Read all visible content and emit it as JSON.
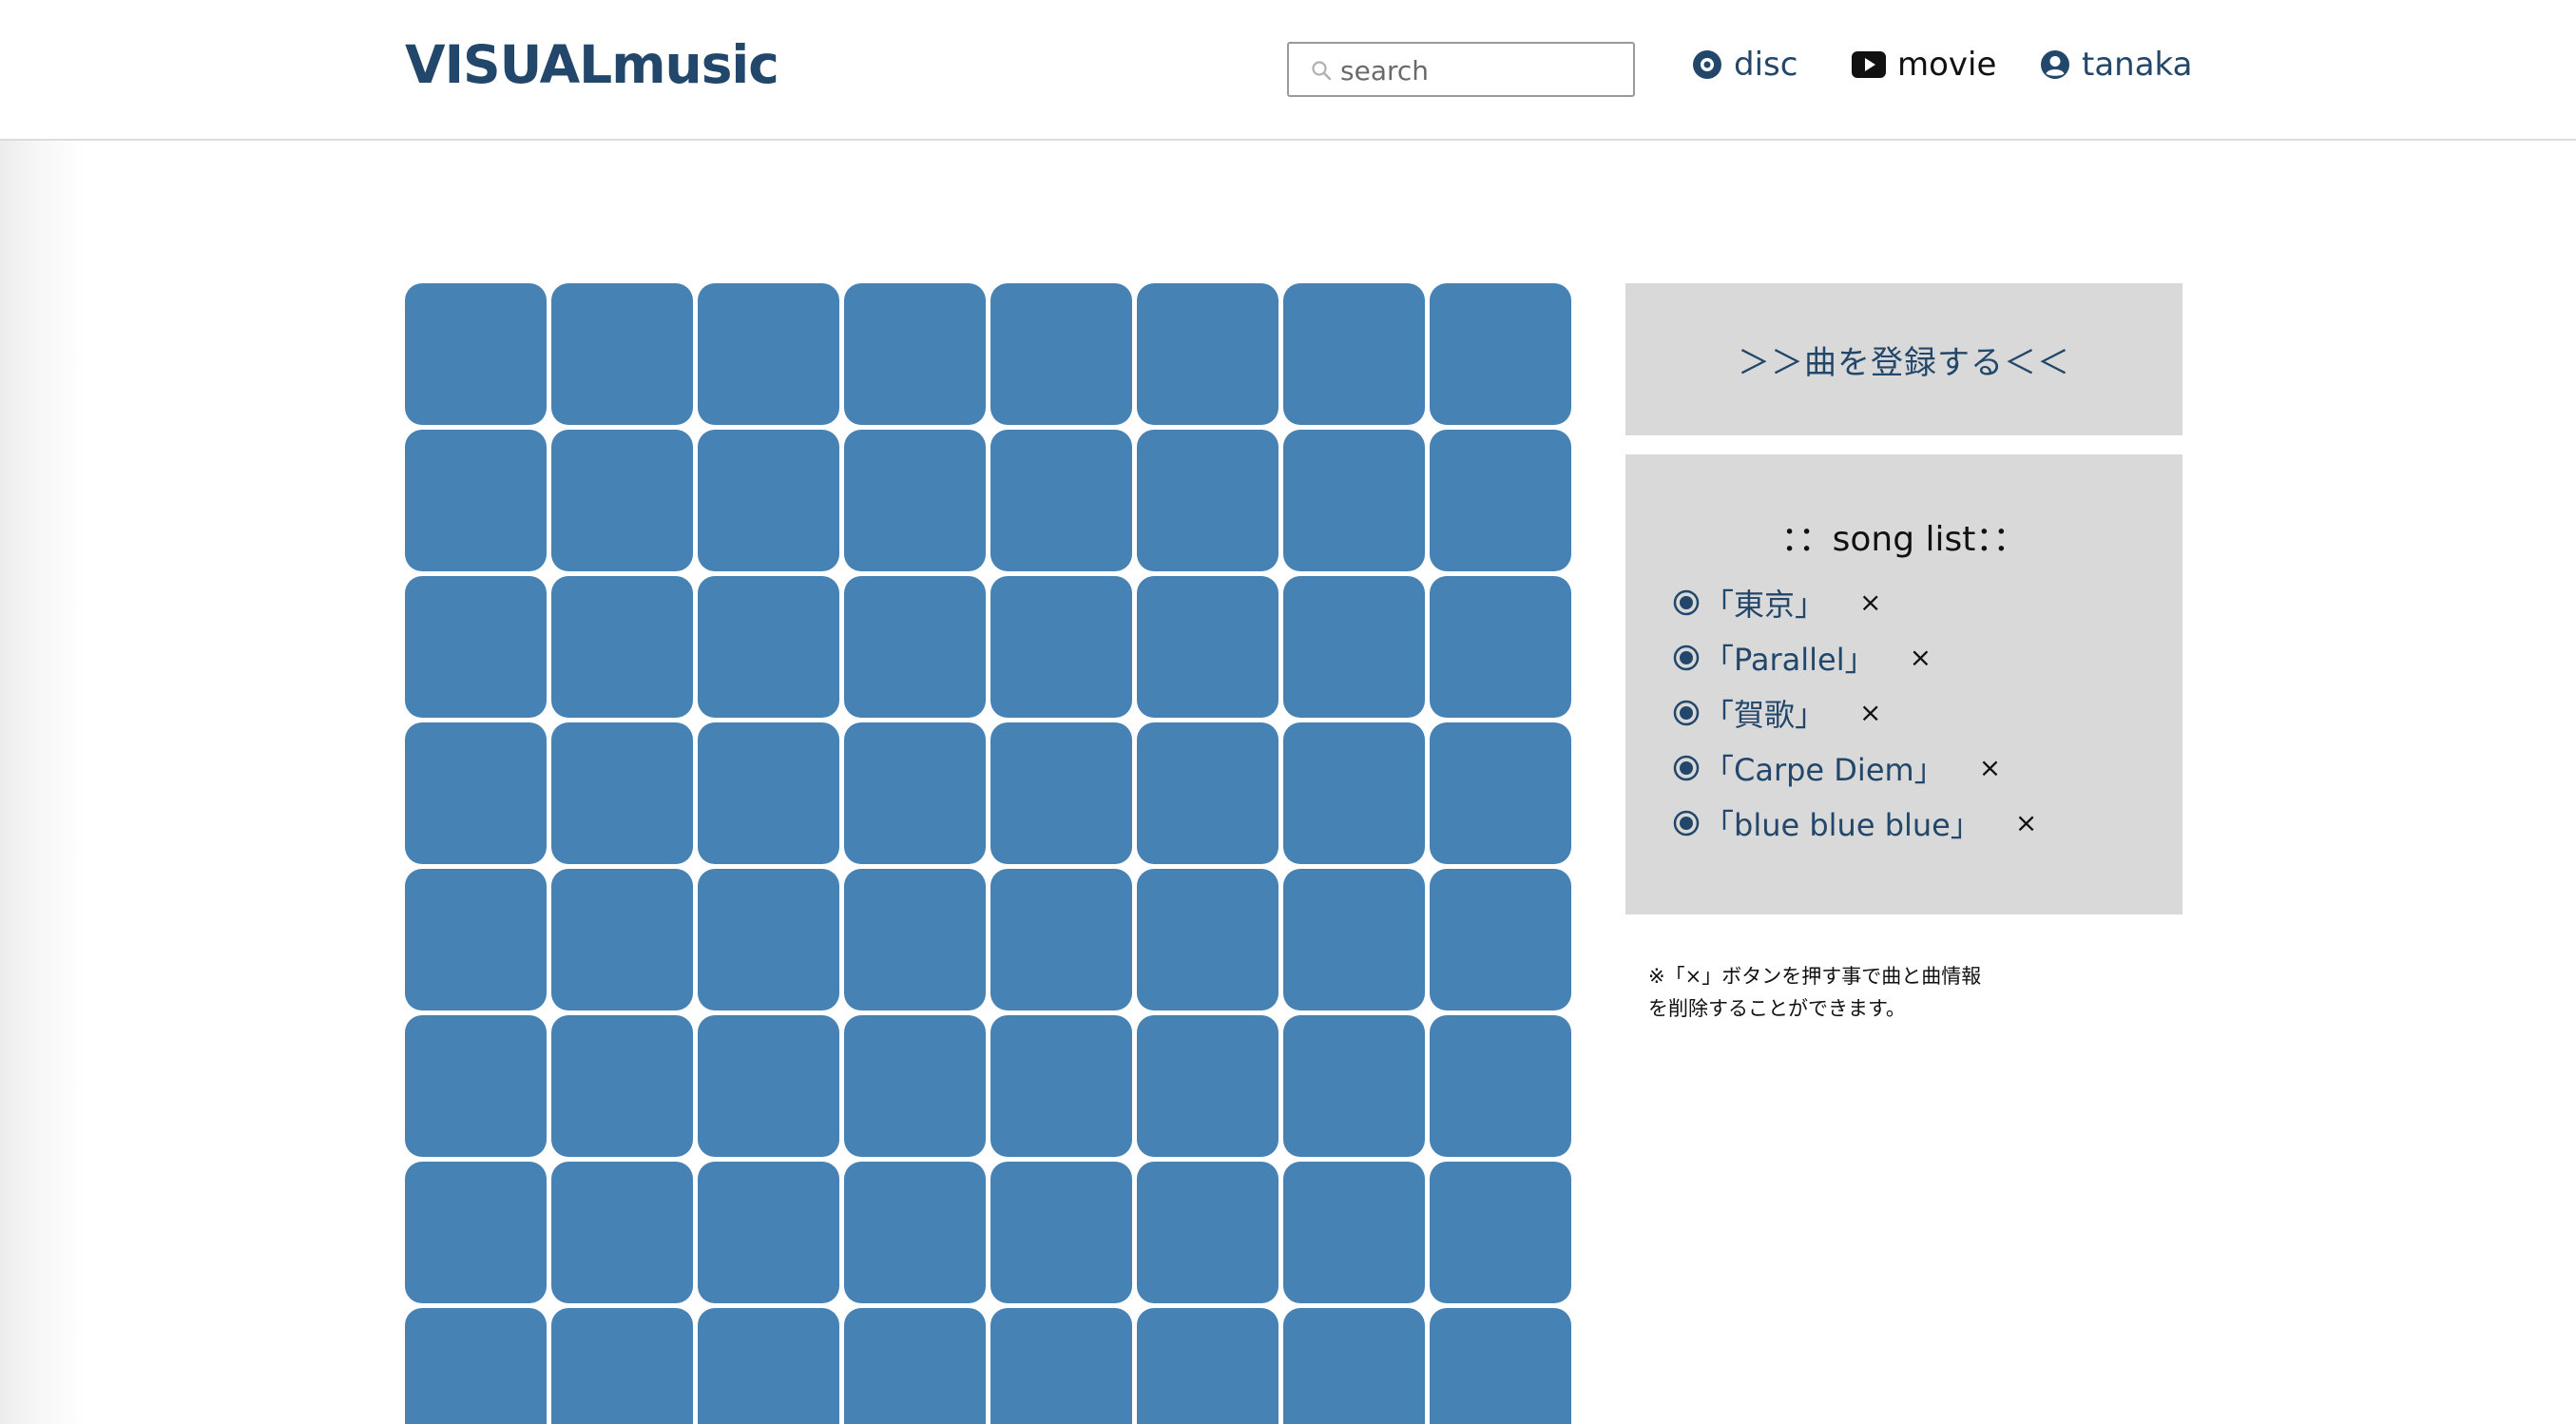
{
  "header": {
    "logo": "VISUALmusic",
    "search": {
      "placeholder": "search",
      "value": ""
    },
    "nav": [
      {
        "label": "disc",
        "icon": "disc-icon"
      },
      {
        "label": "movie",
        "icon": "play-icon"
      },
      {
        "label": "tanaka",
        "icon": "user-icon"
      }
    ]
  },
  "colors": {
    "brand": "#22476a",
    "tile": "#4682b4",
    "panel": "#d9d9d9"
  },
  "grid": {
    "columns": 8,
    "rows_visible": 8
  },
  "sidebar": {
    "register_label": "＞＞曲を登録する＜＜",
    "songlist_title": "：：song list：：",
    "songs": [
      {
        "title": "「東京」",
        "delete": "×"
      },
      {
        "title": "「Parallel」",
        "delete": "×"
      },
      {
        "title": "「賀歌」",
        "delete": "×"
      },
      {
        "title": "「Carpe Diem」",
        "delete": "×"
      },
      {
        "title": "「blue blue blue」",
        "delete": "×"
      }
    ],
    "note_line1": "※「×」ボタンを押す事で曲と曲情報",
    "note_line2": "を削除することができます。"
  }
}
